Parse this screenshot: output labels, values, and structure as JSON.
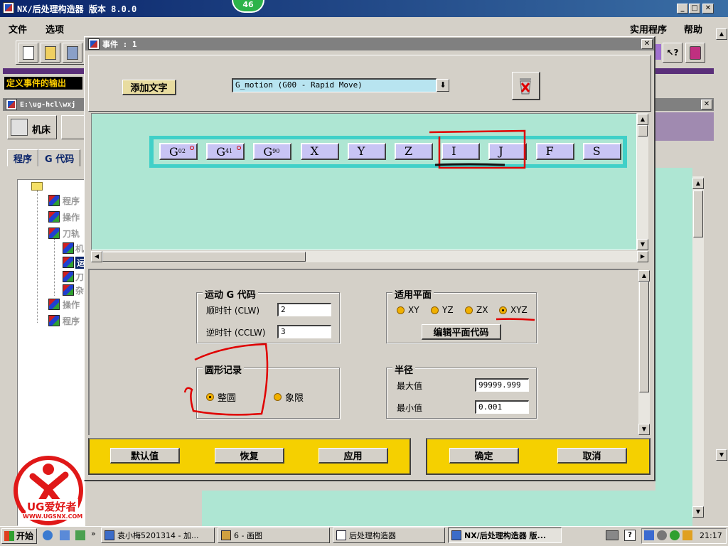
{
  "main_window": {
    "title": "NX/后处理构造器 版本 8.0.0",
    "badge": "46",
    "menu_left": [
      "文件",
      "选项"
    ],
    "menu_right": [
      "实用程序",
      "帮助"
    ],
    "status_bar_text": "定义事件的输出"
  },
  "sub_window": {
    "title": "E:\\ug-hcl\\wxj",
    "tool_label": "机床",
    "tabs": [
      "程序",
      "G 代码"
    ],
    "tree_items": [
      "程序",
      "操作",
      "刀轨",
      "机",
      "运",
      "刀",
      "杂",
      "操作",
      "程序"
    ]
  },
  "dialog": {
    "title": "事件 : 1",
    "add_text_button": "添加文字",
    "address_select_value": "G_motion (G00 - Rapid Move)",
    "blocks": [
      {
        "label": "G",
        "sub": "02",
        "marker": true
      },
      {
        "label": "G",
        "sub": "41",
        "marker": true
      },
      {
        "label": "G",
        "sub": "90",
        "marker": false
      },
      {
        "label": "X",
        "sub": "",
        "marker": false
      },
      {
        "label": "Y",
        "sub": "",
        "marker": false
      },
      {
        "label": "Z",
        "sub": "",
        "marker": false
      },
      {
        "label": "I",
        "sub": "",
        "marker": false
      },
      {
        "label": "J",
        "sub": "",
        "marker": false
      },
      {
        "label": "F",
        "sub": "",
        "marker": false
      },
      {
        "label": "S",
        "sub": "",
        "marker": false
      }
    ],
    "motion_group": {
      "title": "运动 G 代码",
      "clw_label": "顺时针 (CLW)",
      "clw_value": "2",
      "cclw_label": "逆时针 (CCLW)",
      "cclw_value": "3"
    },
    "plane_group": {
      "title": "适用平面",
      "options": [
        "XY",
        "YZ",
        "ZX",
        "XYZ"
      ],
      "selected": "XYZ",
      "edit_button": "编辑平面代码"
    },
    "circle_group": {
      "title": "圆形记录",
      "options": [
        "整圆",
        "象限"
      ],
      "selected": "整圆"
    },
    "radius_group": {
      "title": "半径",
      "max_label": "最大值",
      "max_value": "99999.999",
      "min_label": "最小值",
      "min_value": "0.001"
    },
    "buttons": {
      "default": "默认值",
      "restore": "恢复",
      "apply": "应用",
      "ok": "确定",
      "cancel": "取消"
    }
  },
  "watermark": {
    "brand": "UG爱好者",
    "url": "WWW.UGSNX.COM"
  },
  "taskbar": {
    "start": "开始",
    "items": [
      "袁小梅5201314 - 加...",
      "6 - 画图",
      "后处理构造器",
      "NX/后处理构造器 版..."
    ],
    "clock": "21:17"
  },
  "colors": {
    "titlebar": "#0a246a",
    "block_canvas": "#aee6d3",
    "block_strip": "#40d0c8",
    "bottom_bar": "#f5d000",
    "annotation": "#e00000"
  }
}
